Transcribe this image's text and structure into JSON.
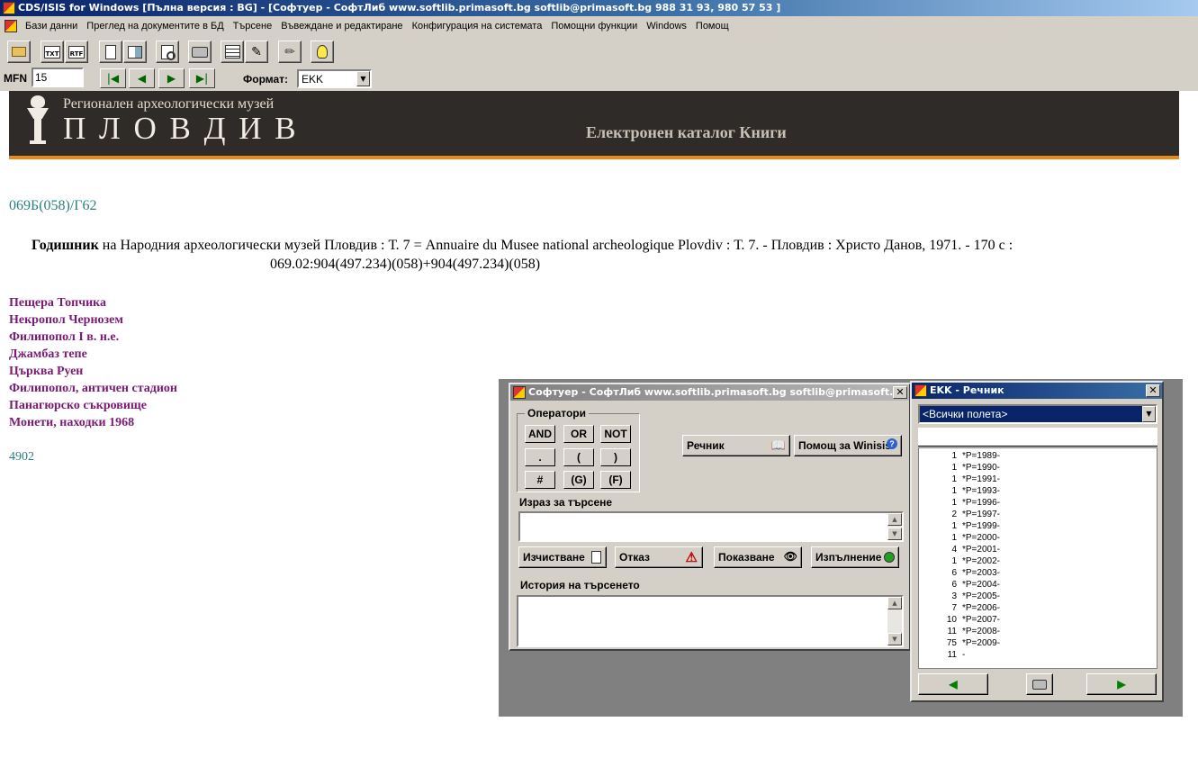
{
  "window": {
    "title": "CDS/ISIS for Windows [Пълна версия : BG] - [Софтуер - СофтЛиб www.softlib.primasoft.bg softlib@primasoft.bg 988 31 93, 980 57 53  ]"
  },
  "menu": {
    "items": [
      "Бази данни",
      "Преглед на документите в БД",
      "Търсене",
      "Въвеждане и редактиране",
      "Конфигурация на системата",
      "Помощни функции",
      "Windows",
      "Помощ"
    ]
  },
  "toolbar": {
    "buttons": [
      {
        "icon": "open-folder-icon"
      },
      {
        "icon": "export-txt-icon",
        "label": "TXT"
      },
      {
        "icon": "export-rtf-icon",
        "label": "RTF"
      },
      {
        "icon": "copy-icon"
      },
      {
        "icon": "paste-icon"
      },
      {
        "icon": "preview-icon"
      },
      {
        "icon": "printer-icon"
      },
      {
        "icon": "form-icon"
      },
      {
        "icon": "edit-icon"
      },
      {
        "icon": "pencil-icon"
      },
      {
        "icon": "lightbulb-icon"
      }
    ]
  },
  "nav": {
    "mfn_label": "MFN",
    "mfn_value": "15",
    "format_label": "Формат:",
    "format_value": "EKK"
  },
  "banner": {
    "subtitle": "Регионален археологически музей",
    "city": "П Л О В Д И В",
    "catalog": "Електронен каталог Книги"
  },
  "record": {
    "call_number": "069Б(058)/Г62",
    "title_bold": "Годишник",
    "title_rest": " на Народния археологически музей Пловдив  : Т. 7 = Annuaire du Musee national archeologique Plovdiv : Т. 7. - Пловдив : Христо Данов, 1971. - 170 с :",
    "udc": "069.02:904(497.234)(058)+904(497.234)(058)",
    "subjects": [
      "Пещера Топчика",
      "Некропол Чернозем",
      "Филипопол I в. н.е.",
      "Джамбаз тепе",
      "Църква Руен",
      "Филипопол, античен стадион",
      "Панагюрско съкровище",
      "Монети, находки 1968"
    ],
    "inventory": "4902"
  },
  "search_dialog": {
    "title": "Софтуер - СофтЛиб www.softlib.primasoft.bg softlib@primasoft.bg",
    "operators_label": "Оператори",
    "operators": [
      "AND",
      "OR",
      "NOT",
      ".",
      "(",
      ")",
      "#",
      "(G)",
      "(F)"
    ],
    "dictionary_button": "Речник",
    "help_button": "Помощ за Winisis",
    "expression_label": "Израз за търсене",
    "expression_value": "",
    "clear_button": "Изчистване",
    "cancel_button": "Отказ",
    "show_button": "Показване",
    "execute_button": "Изпълнение",
    "history_label": "История на търсенето"
  },
  "dict_dialog": {
    "title": "EKK - Речник",
    "field_select": "<Всички полета>",
    "search_value": "",
    "entries": [
      {
        "count": "1",
        "term": "*P=1989-"
      },
      {
        "count": "1",
        "term": "*P=1990-"
      },
      {
        "count": "1",
        "term": "*P=1991-"
      },
      {
        "count": "1",
        "term": "*P=1993-"
      },
      {
        "count": "1",
        "term": "*P=1996-"
      },
      {
        "count": "2",
        "term": "*P=1997-"
      },
      {
        "count": "1",
        "term": "*P=1999-"
      },
      {
        "count": "1",
        "term": "*P=2000-"
      },
      {
        "count": "4",
        "term": "*P=2001-"
      },
      {
        "count": "1",
        "term": "*P=2002-"
      },
      {
        "count": "6",
        "term": "*P=2003-"
      },
      {
        "count": "6",
        "term": "*P=2004-"
      },
      {
        "count": "3",
        "term": "*P=2005-"
      },
      {
        "count": "7",
        "term": "*P=2006-"
      },
      {
        "count": "10",
        "term": "*P=2007-"
      },
      {
        "count": "11",
        "term": "*P=2008-"
      },
      {
        "count": "75",
        "term": "*P=2009-"
      },
      {
        "count": "11",
        "term": "-"
      }
    ]
  },
  "colors": {
    "title_bar": "#0a246a",
    "banner_bg": "#2f2b28",
    "banner_stripe": "#e88a1a",
    "call_number": "#2a7f7f",
    "subject_link": "#7b1a75",
    "mdi_background": "#808080"
  }
}
